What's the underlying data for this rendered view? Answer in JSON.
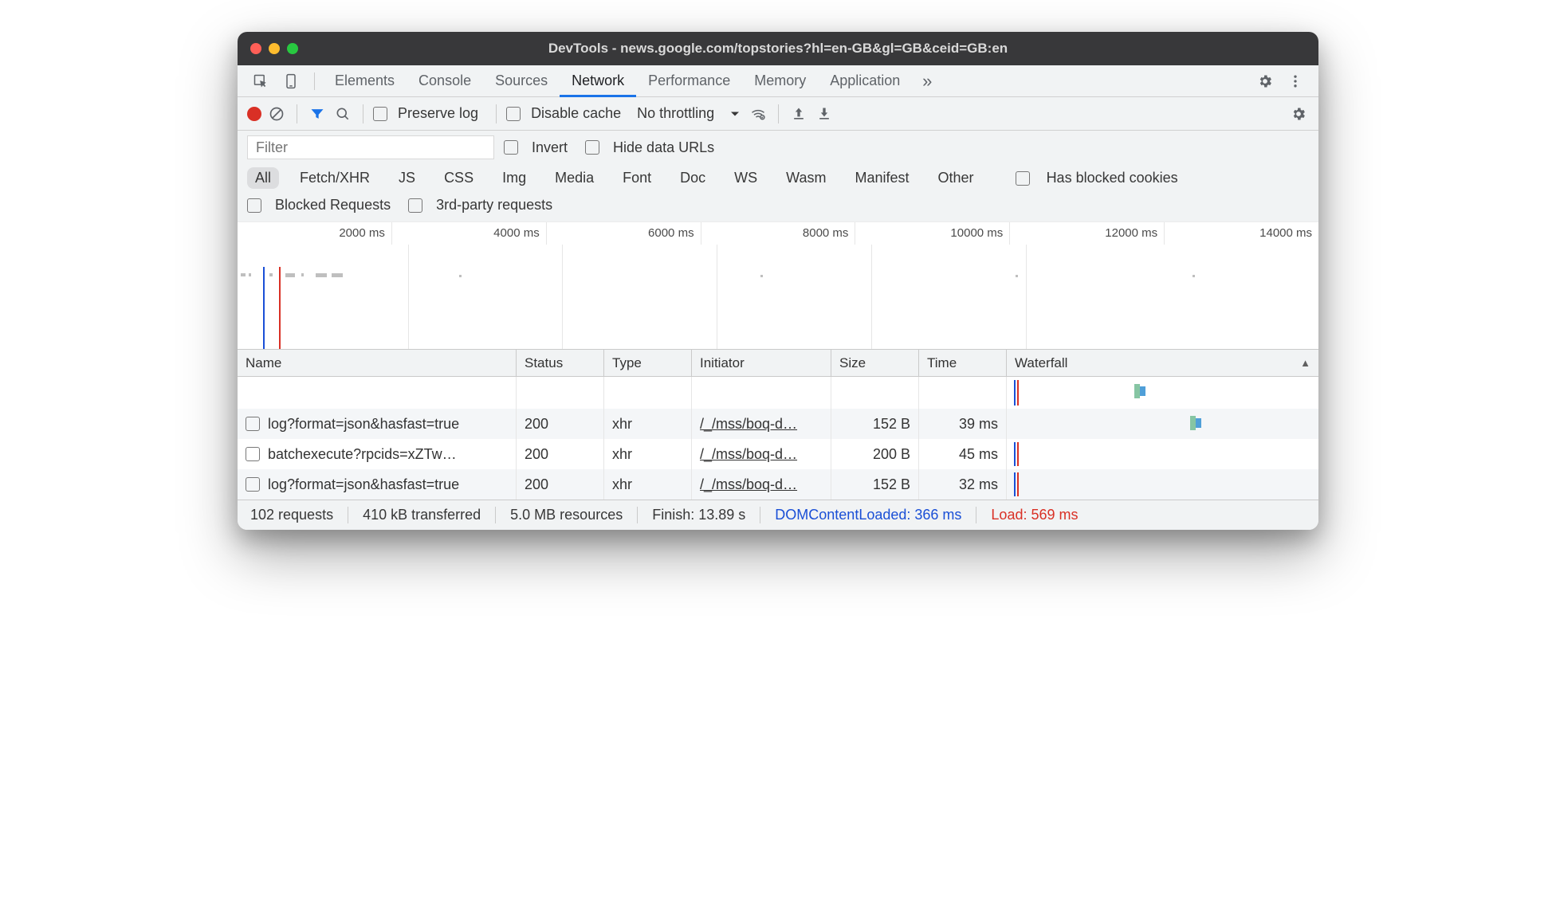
{
  "title": "DevTools - news.google.com/topstories?hl=en-GB&gl=GB&ceid=GB:en",
  "tabs": [
    "Elements",
    "Console",
    "Sources",
    "Network",
    "Performance",
    "Memory",
    "Application"
  ],
  "active_tab": "Network",
  "toolbar": {
    "preserve_log": "Preserve log",
    "disable_cache": "Disable cache",
    "throttling": "No throttling"
  },
  "filter": {
    "placeholder": "Filter",
    "invert": "Invert",
    "hide_data_urls": "Hide data URLs",
    "types": [
      "All",
      "Fetch/XHR",
      "JS",
      "CSS",
      "Img",
      "Media",
      "Font",
      "Doc",
      "WS",
      "Wasm",
      "Manifest",
      "Other"
    ],
    "active_type": "All",
    "has_blocked_cookies": "Has blocked cookies",
    "blocked_requests": "Blocked Requests",
    "third_party": "3rd-party requests"
  },
  "timeline_ticks": [
    "2000 ms",
    "4000 ms",
    "6000 ms",
    "8000 ms",
    "10000 ms",
    "12000 ms",
    "14000 ms"
  ],
  "columns": {
    "name": "Name",
    "status": "Status",
    "type": "Type",
    "initiator": "Initiator",
    "size": "Size",
    "time": "Time",
    "waterfall": "Waterfall"
  },
  "requests": [
    {
      "name": "log?format=json&hasfast=true",
      "status": "200",
      "type": "xhr",
      "initiator": "/_/mss/boq-d…",
      "size": "152 B",
      "time": "39 ms"
    },
    {
      "name": "batchexecute?rpcids=xZTw…",
      "status": "200",
      "type": "xhr",
      "initiator": "/_/mss/boq-d…",
      "size": "200 B",
      "time": "45 ms"
    },
    {
      "name": "log?format=json&hasfast=true",
      "status": "200",
      "type": "xhr",
      "initiator": "/_/mss/boq-d…",
      "size": "152 B",
      "time": "32 ms"
    }
  ],
  "statusbar": {
    "requests": "102 requests",
    "transferred": "410 kB transferred",
    "resources": "5.0 MB resources",
    "finish": "Finish: 13.89 s",
    "dcl": "DOMContentLoaded: 366 ms",
    "load": "Load: 569 ms"
  }
}
